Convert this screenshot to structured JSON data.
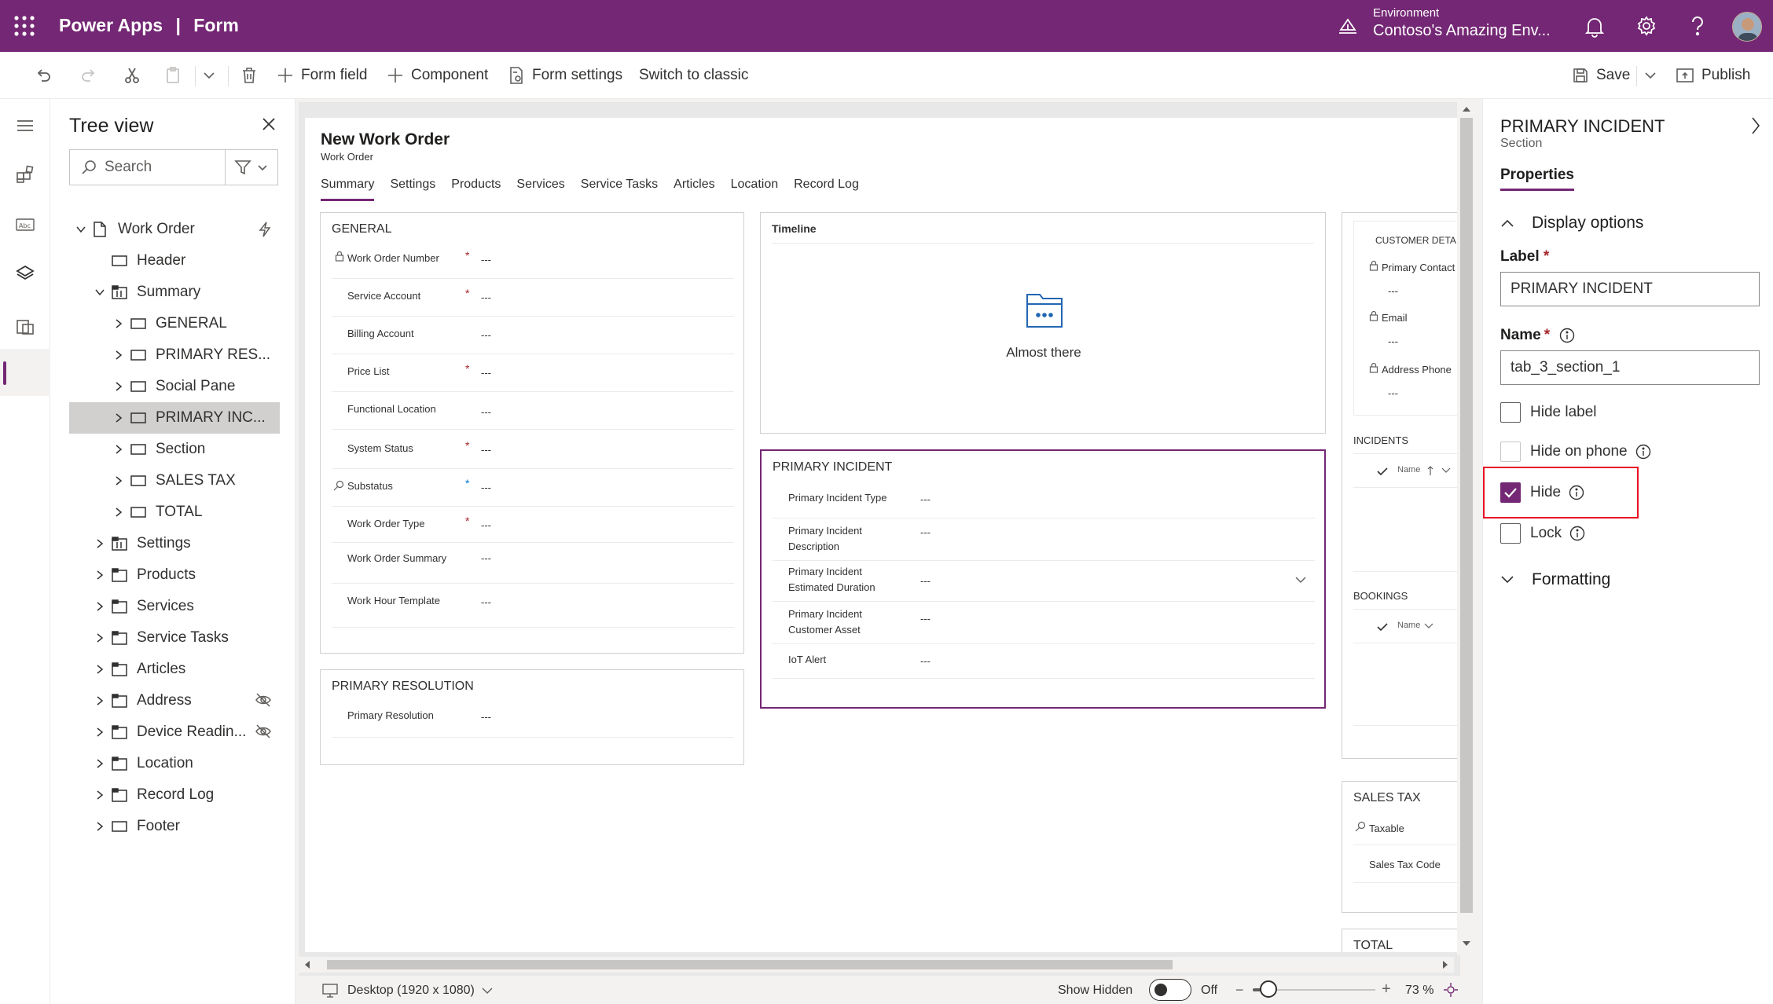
{
  "app": {
    "product": "Power Apps",
    "separator": "|",
    "page": "Form",
    "environment_label": "Environment",
    "environment_name": "Contoso's Amazing Env..."
  },
  "toolbar": {
    "form_field": "Form field",
    "component": "Component",
    "form_settings": "Form settings",
    "switch_classic": "Switch to classic",
    "save": "Save",
    "publish": "Publish"
  },
  "tree": {
    "title": "Tree view",
    "search_placeholder": "Search",
    "items": [
      {
        "label": "Work Order"
      },
      {
        "label": "Header"
      },
      {
        "label": "Summary"
      },
      {
        "label": "GENERAL"
      },
      {
        "label": "PRIMARY RES..."
      },
      {
        "label": "Social Pane"
      },
      {
        "label": "PRIMARY INC..."
      },
      {
        "label": "Section"
      },
      {
        "label": "SALES TAX"
      },
      {
        "label": "TOTAL"
      },
      {
        "label": "Settings"
      },
      {
        "label": "Products"
      },
      {
        "label": "Services"
      },
      {
        "label": "Service Tasks"
      },
      {
        "label": "Articles"
      },
      {
        "label": "Address"
      },
      {
        "label": "Device Readin..."
      },
      {
        "label": "Location"
      },
      {
        "label": "Record Log"
      },
      {
        "label": "Footer"
      }
    ]
  },
  "form": {
    "title": "New Work Order",
    "entity": "Work Order",
    "tabs": [
      "Summary",
      "Settings",
      "Products",
      "Services",
      "Service Tasks",
      "Articles",
      "Location",
      "Record Log"
    ],
    "general": {
      "title": "GENERAL",
      "fields": [
        {
          "label": "Work Order Number",
          "value": "---"
        },
        {
          "label": "Service Account",
          "value": "---"
        },
        {
          "label": "Billing Account",
          "value": "---"
        },
        {
          "label": "Price List",
          "value": "---"
        },
        {
          "label": "Functional Location",
          "value": "---"
        },
        {
          "label": "System Status",
          "value": "---"
        },
        {
          "label": "Substatus",
          "value": "---"
        },
        {
          "label": "Work Order Type",
          "value": "---"
        },
        {
          "label": "Work Order Summary",
          "value": "---"
        },
        {
          "label": "Work Hour Template",
          "value": "---"
        }
      ]
    },
    "primary_resolution": {
      "title": "PRIMARY RESOLUTION",
      "fields": [
        {
          "label": "Primary Resolution",
          "value": "---"
        }
      ]
    },
    "timeline": {
      "title": "Timeline",
      "message": "Almost there"
    },
    "primary_incident": {
      "title": "PRIMARY INCIDENT",
      "fields": [
        {
          "label": "Primary Incident Type",
          "value": "---"
        },
        {
          "label": "Primary Incident Description",
          "value": "---"
        },
        {
          "label": "Primary Incident Estimated Duration",
          "value": "---"
        },
        {
          "label": "Primary Incident Customer Asset",
          "value": "---"
        },
        {
          "label": "IoT Alert",
          "value": "---"
        }
      ]
    },
    "customer": {
      "title": "CUSTOMER DETA",
      "fields": [
        {
          "label": "Primary Contact",
          "value": "---"
        },
        {
          "label": "Email",
          "value": "---"
        },
        {
          "label": "Address Phone",
          "value": "---"
        }
      ]
    },
    "incidents": {
      "title": "INCIDENTS",
      "col": "Name"
    },
    "bookings": {
      "title": "BOOKINGS",
      "col": "Name"
    },
    "sales_tax": {
      "title": "SALES TAX",
      "fields": [
        {
          "label": "Taxable"
        },
        {
          "label": "Sales Tax Code"
        }
      ]
    },
    "total": {
      "title": "TOTAL"
    }
  },
  "props": {
    "title": "PRIMARY INCIDENT",
    "subtitle": "Section",
    "tab": "Properties",
    "display_options": "Display options",
    "label_caption": "Label",
    "label_value": "PRIMARY INCIDENT",
    "name_caption": "Name",
    "name_value": "tab_3_section_1",
    "hide_label": "Hide label",
    "hide_on_phone": "Hide on phone",
    "hide": "Hide",
    "lock": "Lock",
    "formatting": "Formatting",
    "required_mark": "*"
  },
  "bottom": {
    "device": "Desktop (1920 x 1080)",
    "show_hidden": "Show Hidden",
    "toggle_state": "Off",
    "zoom": "73 %",
    "zoom_level": 0.73
  },
  "colors": {
    "brand": "#742774",
    "highlight": "#e81123"
  }
}
